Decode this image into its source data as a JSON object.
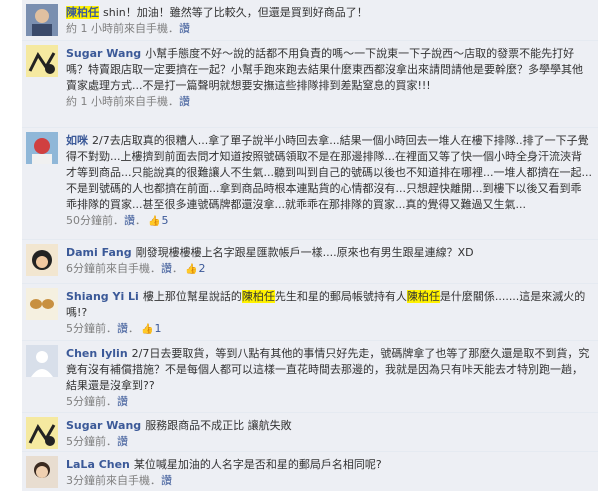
{
  "comments": [
    {
      "author": "陳柏任",
      "text": "shin！加油！雖然等了比較久，但還是買到好商品了！",
      "time": "約 1 小時前來自手機",
      "like": "讚",
      "likes": ""
    },
    {
      "author": "Sugar Wang",
      "text": "小幫手態度不好～說的話都不用負責的嗎～一下說東一下子說西～店取的發票不能先打好嗎？特賣跟店取一定要擠在一起？小幫手跑來跑去結果什麼東西都沒拿出來請問請他是要幹麼？多學學其他賣家處理方式...不是打一篇聲明就想要安撫這些排隊排到差點窒息的買家!!!",
      "time": "約 1 小時前來自手機",
      "like": "讚",
      "likes": ""
    },
    {
      "author": "如咪",
      "text": "2/7去店取真的很糟人...拿了單子說半小時回去拿...結果一個小時回去一堆人在樓下排隊..排了一下子覺得不對勁...上樓擠到前面去問才知道按照號碼領取不是在那邊排隊...在裡面又等了快一個小時全身汗流浹背才等到商品...只能說真的很難讓人不生氣...聽到叫到自己的號碼以後也不知道排在哪裡...一堆人都擠在一起...不是到號碼的人也都擠在前面...拿到商品時根本連點貨的心情都沒有...只想趕快離開...到樓下以後又看到乖乖排隊的買家...甚至很多連號碼牌都還沒拿...就乖乖在那排隊的買家...真的覺得又難過又生氣...",
      "time": "50分鐘前",
      "like": "讚",
      "likes": "5"
    },
    {
      "author": "Dami Fang",
      "text": "剛發現樓樓樓上名字跟星匯款帳戶一樣....原來也有男生跟星連線？XD",
      "time": "6分鐘前來自手機",
      "like": "讚",
      "likes": "2"
    },
    {
      "author": "Shiang Yi Li",
      "text_a": "樓上那位幫星說話的",
      "hl_a": "陳柏任",
      "text_b": "先生和星的郵局帳號持有人",
      "hl_b": "陳柏任",
      "text_c": "是什麼關係.......這是來滅火的嗎!?",
      "time": "5分鐘前",
      "like": "讚",
      "likes": "1"
    },
    {
      "author": "Chen Iylin",
      "text": "2/7日去要取貨，等到八點有其他的事情只好先走，號碼牌拿了也等了那麼久還是取不到貨，究竟有沒有補償措施？不是每個人都可以這樣一直花時間去那邊的，我就是因為只有咔天能去才特別跑一趟，結果還是沒拿到??",
      "time": "5分鐘前",
      "like": "讚",
      "likes": ""
    },
    {
      "author": "Sugar Wang",
      "text": "服務跟商品不成正比 讓航失敗",
      "time": "5分鐘前",
      "like": "讚",
      "likes": ""
    },
    {
      "author": "LaLa Chen",
      "text": "某位喊星加油的人名字是否和星的郵局戶名相同呢?",
      "time": "3分鐘前來自手機",
      "like": "讚",
      "likes": ""
    }
  ],
  "meta_sep": "．",
  "like_icon": "thumbs-up-icon",
  "colors": {
    "link": "#3b5998",
    "highlight": "#fff200",
    "feed_bg": "#edeff4",
    "meta": "#808080"
  }
}
